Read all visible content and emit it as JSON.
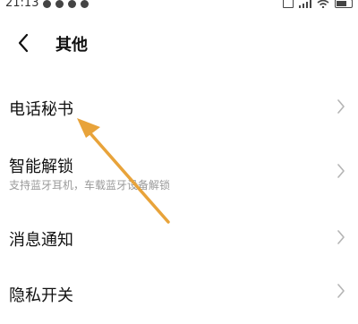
{
  "status_bar": {
    "time": "21:13"
  },
  "header": {
    "title": "其他"
  },
  "menu": {
    "items": [
      {
        "label": "电话秘书",
        "subtitle": ""
      },
      {
        "label": "智能解锁",
        "subtitle": "支持蓝牙耳机，车载蓝牙设备解锁"
      },
      {
        "label": "消息通知",
        "subtitle": ""
      },
      {
        "label": "隐私开关",
        "subtitle": ""
      }
    ]
  },
  "colors": {
    "annotation_arrow": "#e8a33a",
    "chevron": "#b5b5b5",
    "subtitle_text": "#9a9a9a"
  }
}
